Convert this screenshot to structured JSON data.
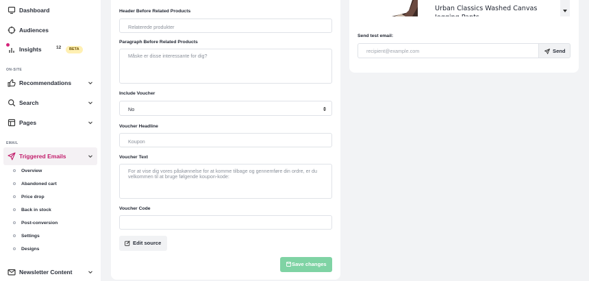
{
  "sidebar": {
    "dashboard": "Dashboard",
    "audiences": "Audiences",
    "insights": "Insights",
    "insights_count": "12",
    "insights_badge": "BETA",
    "section_onsite": "ON-SITE",
    "recommendations": "Recommendations",
    "search": "Search",
    "pages": "Pages",
    "section_email": "EMAIL",
    "triggered_emails": "Triggered Emails",
    "sub_items": [
      "Overview",
      "Abandoned cart",
      "Price drop",
      "Back in stock",
      "Post-conversion",
      "Settings",
      "Designs"
    ],
    "newsletter": "Newsletter Content",
    "accent_color": "#c21d6b"
  },
  "form": {
    "header_label": "Header Before Related Products",
    "header_value": "Relaterede produkter",
    "paragraph_label": "Paragraph Before Related Products",
    "paragraph_value": "Måske er disse interessante for dig?",
    "voucher_label": "Include Voucher",
    "voucher_value": "No",
    "headline_label": "Voucher Headline",
    "headline_value": "Koupon",
    "text_label": "Voucher Text",
    "text_value": "For at vise dig vores påskønnelse for at komme tilbage og gennemføre din ordre, er du velkommen til at bruge følgende koupon-kode:",
    "code_label": "Voucher Code",
    "code_value": "",
    "edit_source": "Edit source",
    "save_changes": "Save changes",
    "save_color": "#7fd3a4"
  },
  "preview": {
    "product_title": "Urban Classics Washed Canvas Jogging Pants",
    "test_email_label": "Send test email:",
    "email_placeholder": "recipient@example.com",
    "send": "Send"
  }
}
